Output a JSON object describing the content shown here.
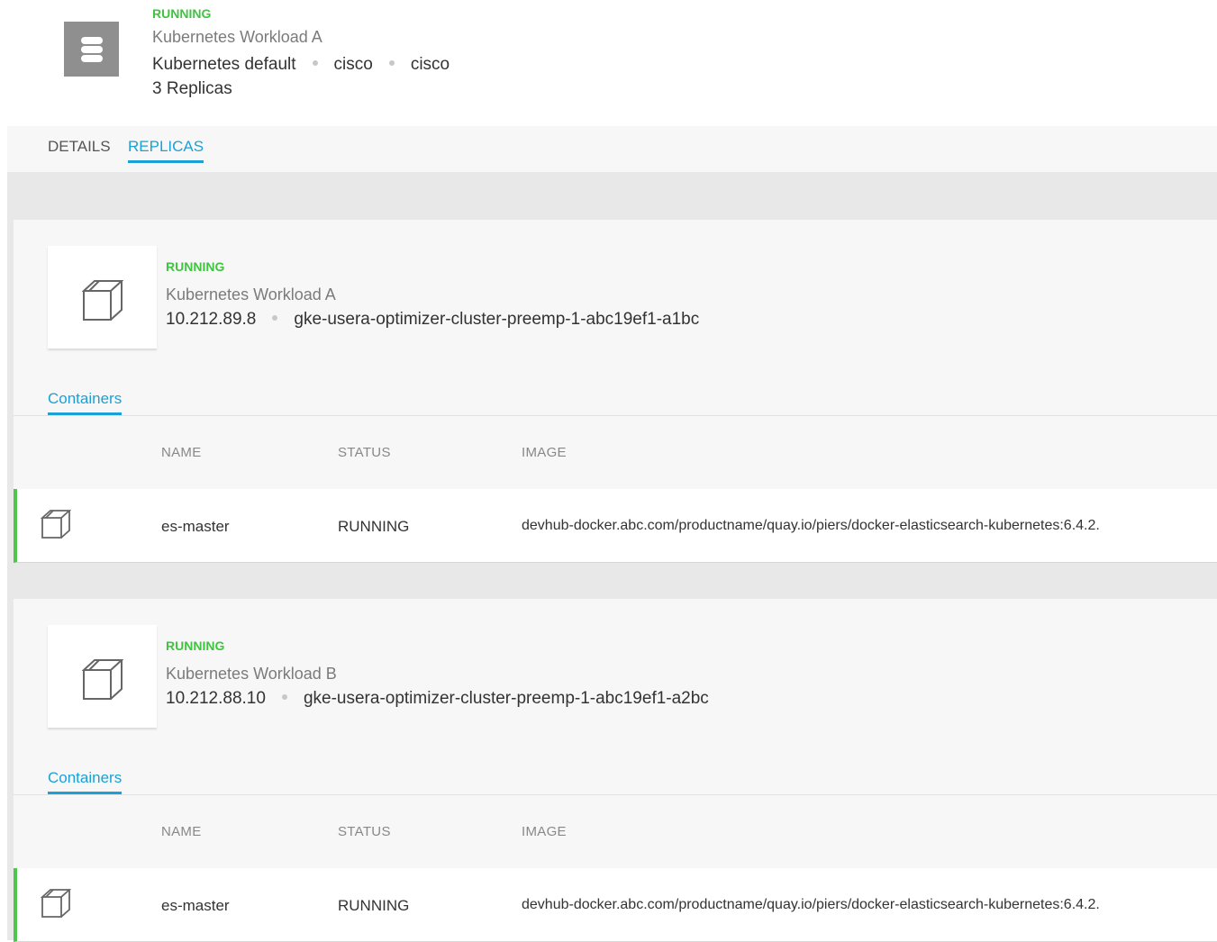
{
  "header": {
    "status": "RUNNING",
    "title": "Kubernetes Workload A",
    "meta": [
      "Kubernetes default",
      "cisco",
      "cisco"
    ],
    "replicas_label": "3 Replicas",
    "icon": "server-stack-icon"
  },
  "tabs": [
    {
      "label": "DETAILS",
      "active": false
    },
    {
      "label": "REPLICAS",
      "active": true
    }
  ],
  "colors": {
    "running_green": "#3fc43f",
    "accent_blue": "#1ba1d6",
    "row_border_green": "#4cc64c"
  },
  "replicas": [
    {
      "status": "RUNNING",
      "title": "Kubernetes Workload A",
      "ip": "10.212.89.8",
      "node": "gke-usera-optimizer-cluster-preemp-1-abc19ef1-a1bc",
      "icon": "cube-icon",
      "sub_tab": "Containers",
      "columns": [
        "NAME",
        "STATUS",
        "IMAGE"
      ],
      "containers": [
        {
          "name": "es-master",
          "status": "RUNNING",
          "image": "devhub-docker.abc.com/productname/quay.io/piers/docker-elasticsearch-kubernetes:6.4.2."
        }
      ]
    },
    {
      "status": "RUNNING",
      "title": "Kubernetes Workload B",
      "ip": "10.212.88.10",
      "node": "gke-usera-optimizer-cluster-preemp-1-abc19ef1-a2bc",
      "icon": "cube-icon",
      "sub_tab": "Containers",
      "columns": [
        "NAME",
        "STATUS",
        "IMAGE"
      ],
      "containers": [
        {
          "name": "es-master",
          "status": "RUNNING",
          "image": "devhub-docker.abc.com/productname/quay.io/piers/docker-elasticsearch-kubernetes:6.4.2."
        }
      ]
    }
  ]
}
